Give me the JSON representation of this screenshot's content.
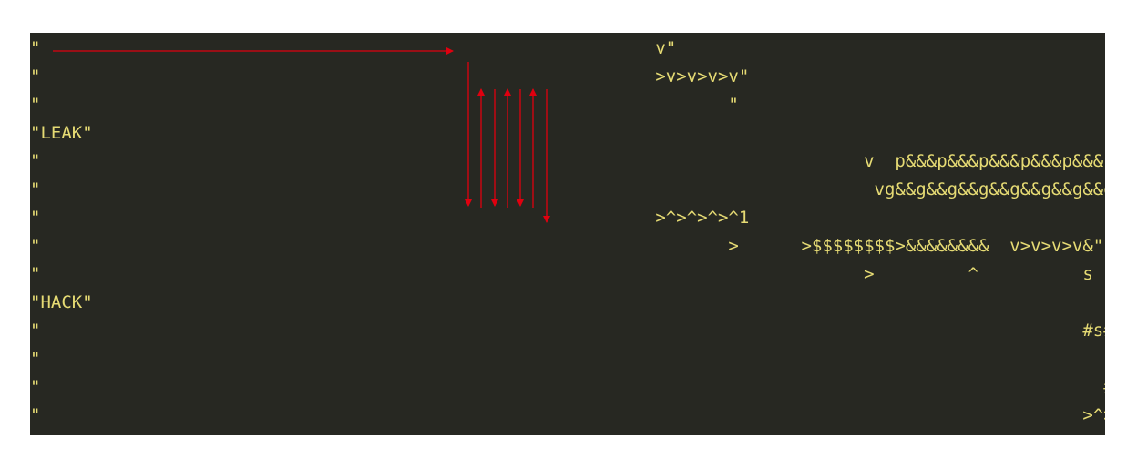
{
  "editor": {
    "text_color": "#e6db74",
    "background": "#272822",
    "lines": [
      "\"                                                           v\"",
      "\"                                                           >v>v>v>v\"",
      "\"                                                                  \"",
      "\"LEAK\"",
      "\"                                                                               v  p&&&p&&&p&&&p&&&p&&&p&&&p&&&p&&&<\"",
      "\"                                                                                vg&&g&&g&&g&&g&&g&&g&&g&&   _      ^\"",
      "\"                                                           >^>^>^>^1                                           \"",
      "\"                                                                  >      >$$$$$$$$>&&&&&&&&  v>v>v>v&\"",
      "\"                                                                               >         ^          s s s s \"",
      "\"HACK\"",
      "\"                                                                                                    #s#s#s#s\"",
      "\"                                                                                                           \"",
      "\"                                                                                                      # # # #\"",
      "\"                                                                                                    >^>^>^>^\""
    ]
  },
  "annotations": {
    "arrow_color": "#e0000f"
  }
}
